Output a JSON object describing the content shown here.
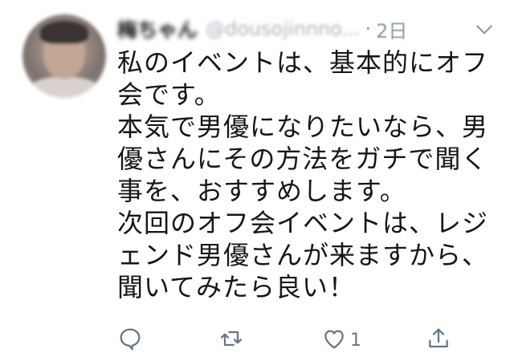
{
  "tweet": {
    "display_name": "梅ちゃん",
    "handle": "@dousojinnno...",
    "separator": "·",
    "timestamp": "2日",
    "lines": [
      "私のイベントは、基本的にオフ",
      "会です。",
      "本気で男優になりたいなら、男",
      "優さんにその方法をガチで聞く",
      "事を、おすすめします。",
      "次回のオフ会イベントは、レジ",
      "ェンド男優さんが来ますから、",
      "聞いてみたら良い！"
    ]
  },
  "actions": {
    "reply": {
      "icon": "reply-icon"
    },
    "retweet": {
      "icon": "retweet-icon"
    },
    "like": {
      "icon": "heart-icon",
      "count": "1"
    },
    "share": {
      "icon": "share-icon"
    }
  },
  "colors": {
    "text": "#14171a",
    "secondary": "#657786",
    "muted": "#8899a6"
  }
}
